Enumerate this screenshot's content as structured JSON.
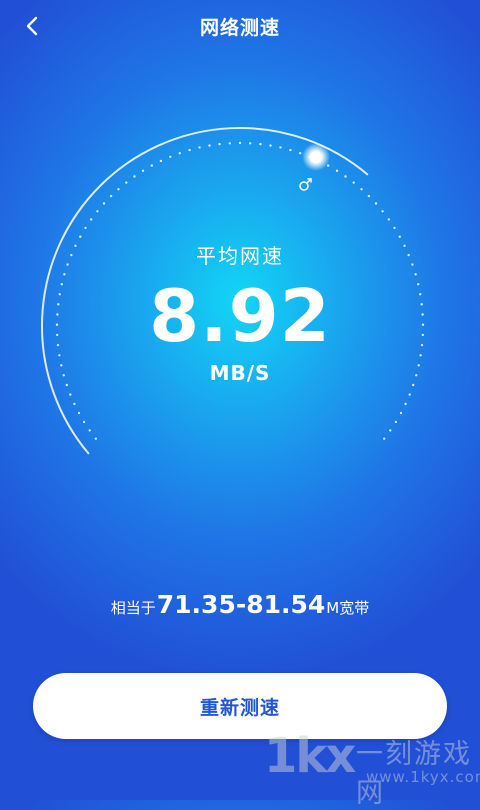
{
  "header": {
    "title": "网络测速",
    "back_icon": "chevron-left-icon"
  },
  "gauge": {
    "indicator_icon": "indicator-knob-icon",
    "speed_icon": "male-symbol-icon",
    "accent": "#ffffff"
  },
  "result": {
    "label": "平均网速",
    "value": "8.92",
    "unit": "MB/S"
  },
  "equivalent": {
    "prefix": "相当于",
    "range": "71.35-81.54",
    "suffix": "M宽带"
  },
  "actions": {
    "retest_label": "重新测速"
  },
  "watermark": {
    "logo": "1kx",
    "name": "一刻游戏网",
    "url": "www.1kyx.com"
  },
  "colors": {
    "background_center": "#12d6f5",
    "background_edge": "#2150d6",
    "button_text": "#2456d8"
  }
}
